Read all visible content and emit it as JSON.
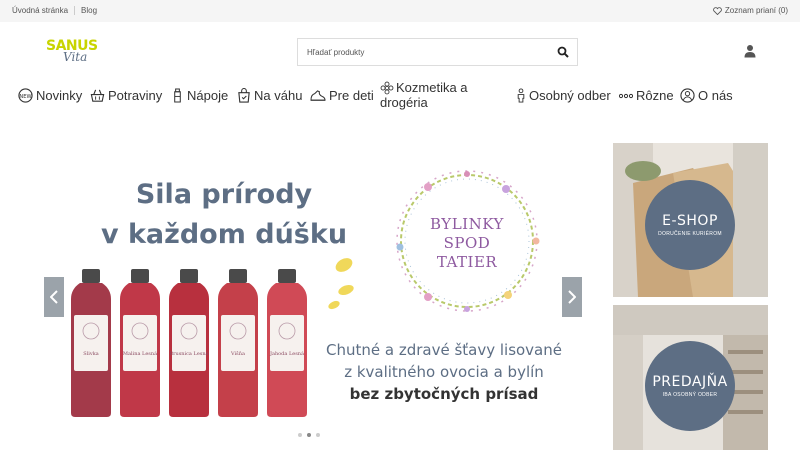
{
  "topbar": {
    "links": [
      "Úvodná stránka",
      "Blog"
    ],
    "wishlist_label": "Zoznam prianí (0)"
  },
  "logo": {
    "line1": "SANUS",
    "line2": "Vita"
  },
  "search": {
    "placeholder": "Hľadať produkty"
  },
  "nav": {
    "items": [
      {
        "label": "Novinky",
        "icon": "new-badge-icon"
      },
      {
        "label": "Potraviny",
        "icon": "grocery-basket-icon"
      },
      {
        "label": "Nápoje",
        "icon": "bottle-icon"
      },
      {
        "label": "Na váhu",
        "icon": "scale-bag-icon"
      },
      {
        "label": "Pre deti",
        "icon": "baby-shoe-icon"
      },
      {
        "label_line1": "Kozmetika a",
        "label_line2": "drogéria",
        "icon": "flower-icon"
      },
      {
        "label": "Osobný odber",
        "icon": "person-pickup-icon"
      },
      {
        "label": "Rôzne",
        "icon": "dots-icon"
      },
      {
        "label": "O nás",
        "icon": "user-circle-icon"
      }
    ]
  },
  "hero": {
    "title_line1": "Sila prírody",
    "title_line2": "v každom dúšku",
    "badge_line1": "BYLINKY",
    "badge_line2": "SPOD",
    "badge_line3": "TATIER",
    "tagline_line1": "Chutné a zdravé šťavy lisované",
    "tagline_line2": "z kvalitného ovocia a bylín",
    "tagline_line3": "bez zbytočných prísad",
    "bottle_labels": [
      "Slivka",
      "Malina Lesná",
      "Brusnica Lesná",
      "Višňa",
      "Jahoda Lesná"
    ],
    "slide_count": 3,
    "active_slide": 2
  },
  "promos": [
    {
      "title": "E-SHOP",
      "subtitle": "DORUČENIE KURIÉROM"
    },
    {
      "title": "PREDAJŇA",
      "subtitle": "IBA OSOBNÝ ODBER"
    }
  ],
  "colors": {
    "accent_blue": "#5d6e84",
    "logo_yellow": "#c8d400",
    "arrow_gray": "#9ba3aa"
  }
}
